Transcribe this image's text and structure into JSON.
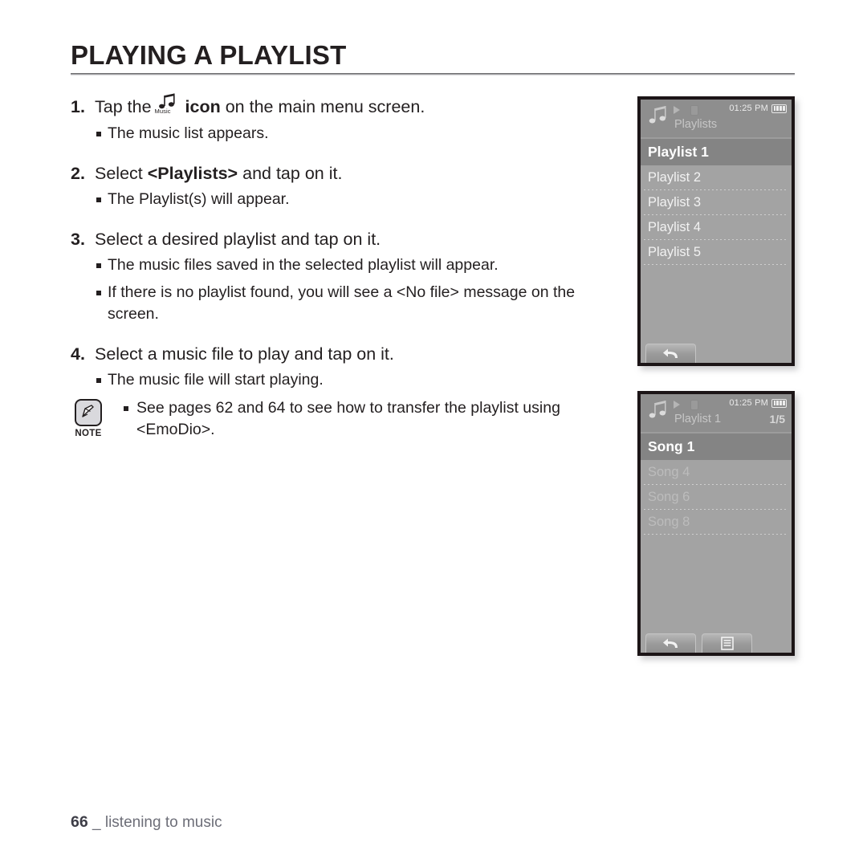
{
  "heading": "PLAYING A PLAYLIST",
  "steps": [
    {
      "num": "1.",
      "text_before": "Tap the",
      "icon": "music-note-icon",
      "icon_label": "Music",
      "text_bold": "icon",
      "text_after": "on the main menu screen.",
      "bullets": [
        "The music list appears."
      ]
    },
    {
      "num": "2.",
      "text_before": "Select",
      "text_bold": "<Playlists>",
      "text_after": "and tap on it.",
      "bullets": [
        "The Playlist(s) will appear."
      ]
    },
    {
      "num": "3.",
      "text_before": "Select a desired playlist and tap on it.",
      "bullets": [
        "The music files saved in the selected playlist will appear.",
        "If there is no playlist found, you will see a <No file> message on the screen."
      ]
    },
    {
      "num": "4.",
      "text_before": "Select a music file to play and tap on it.",
      "bullets": [
        "The music file will start playing."
      ]
    }
  ],
  "note": {
    "label": "NOTE",
    "icon": "note-pen-icon",
    "text": "See pages 62 and 64 to see how to transfer the playlist using <EmoDio>."
  },
  "devices": [
    {
      "name": "playlists-screen",
      "statusbar": {
        "music_icon": "music-note-icon",
        "play_icon": "play-icon",
        "lock_icon": "lock-icon",
        "time": "01:25 PM",
        "battery_icon": "battery-full-icon",
        "title": "Playlists",
        "count": ""
      },
      "rows": [
        {
          "label": "Playlist 1",
          "selected": true
        },
        {
          "label": "Playlist 2",
          "selected": false
        },
        {
          "label": "Playlist 3",
          "selected": false
        },
        {
          "label": "Playlist 4",
          "selected": false
        },
        {
          "label": "Playlist 5",
          "selected": false
        }
      ],
      "softkeys": [
        {
          "name": "back-button",
          "icon": "back-arrow-icon"
        }
      ]
    },
    {
      "name": "playlist-songs-screen",
      "statusbar": {
        "music_icon": "music-note-icon",
        "play_icon": "play-icon",
        "lock_icon": "lock-icon",
        "time": "01:25 PM",
        "battery_icon": "battery-full-icon",
        "title": "Playlist 1",
        "count": "1/5"
      },
      "rows": [
        {
          "label": "Song 1",
          "selected": true
        },
        {
          "label": "Song 4",
          "selected": false
        },
        {
          "label": "Song 6",
          "selected": false
        },
        {
          "label": "Song 8",
          "selected": false
        }
      ],
      "softkeys": [
        {
          "name": "back-button",
          "icon": "back-arrow-icon"
        },
        {
          "name": "menu-button",
          "icon": "list-menu-icon"
        }
      ]
    }
  ],
  "footer": {
    "page_number": "66",
    "separator": "_",
    "section": "listening to music"
  }
}
